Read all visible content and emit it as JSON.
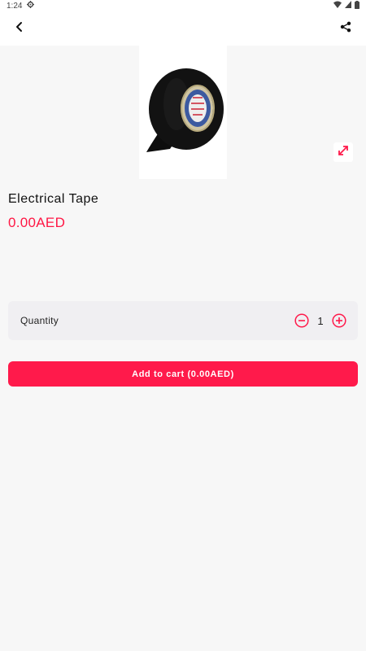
{
  "status_bar": {
    "time": "1:24",
    "icons": [
      "settings-icon",
      "wifi-icon",
      "battery-icon"
    ]
  },
  "app_bar": {
    "back_icon": "chevron-left-icon",
    "share_icon": "share-icon"
  },
  "product": {
    "image": "electrical-tape-image",
    "name": "Electrical Tape",
    "price": "0.00AED"
  },
  "quantity": {
    "label": "Quantity",
    "value": "1",
    "decrement_icon": "minus-circle-icon",
    "increment_icon": "plus-circle-icon"
  },
  "cart": {
    "button_label": "Add to cart (0.00AED)"
  },
  "colors": {
    "accent": "#ff1a4b",
    "background": "#f7f7f7",
    "card": "#f0eff2"
  }
}
